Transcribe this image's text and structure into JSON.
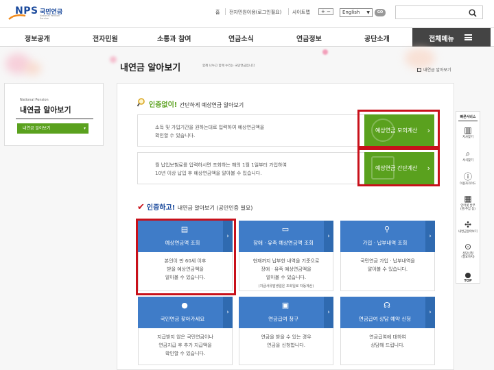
{
  "header": {
    "logo": {
      "brand": "NPS",
      "korean": "국민연금",
      "english": "National Pension Service"
    },
    "util_links": [
      "홈",
      "전자민원이용(로그인필요)",
      "사이트맵"
    ],
    "font_size": {
      "plus": "+",
      "minus": "−"
    },
    "language": {
      "selected": "English"
    },
    "go_label": "GO",
    "search": {
      "placeholder": ""
    }
  },
  "nav": {
    "items": [
      "정보공개",
      "전자민원",
      "소통과 참여",
      "연금소식",
      "연금정보",
      "공단소개"
    ],
    "all_menu": "전체메뉴"
  },
  "page": {
    "title": "내연금 알아보기",
    "subtitle": "함께 나누고 함께 누리는 국민연금입니다",
    "breadcrumb": "내연금 알아보기"
  },
  "sidebar": {
    "small_label": "National Pension",
    "title": "내연금 알아보기",
    "button": "내연금 알아보기"
  },
  "section1": {
    "heading_bold": "인증없이!",
    "heading_rest": "간단하게 예상연금 알아보기",
    "rows": [
      {
        "desc": "소득 및 가입기간을 원하는대로 입력하여 예상연금액을\n확인할 수 있습니다.",
        "button": "예상연금 모의계산"
      },
      {
        "desc": "월 납입보험료를 입력하시면 조회하는 해의 1월 1일부터 가입하여\n10년 이상 납입 후 예상연금액을 알아볼 수 있습니다.",
        "button": "예상연금 간단계산"
      }
    ]
  },
  "section2": {
    "heading_bold": "인증하고!",
    "heading_rest": "내연금 알아보기 (공인인증 필요)",
    "cards": [
      {
        "title": "예상연금액 조회",
        "icon": "document-icon",
        "desc": "본인이 만 60세 이후\n받을 예상연금액을\n알아볼 수 있습니다.",
        "note": ""
      },
      {
        "title": "장애 · 유족 예상연금액 조회",
        "icon": "id-card-icon",
        "desc": "현재까지 납부한 내역을 기준으로\n장애 · 유족 예상연금액을\n알아볼 수 있습니다.",
        "note": "(지급사유발생일은 조회일로 자동계산)"
      },
      {
        "title": "가입 · 납부내역 조회",
        "icon": "magnifier-icon",
        "desc": "국민연금 가입 · 납부내역을\n알아볼 수 있습니다.",
        "note": ""
      },
      {
        "title": "국민연금 찾아가세요",
        "icon": "piggy-bank-icon",
        "desc": "지급받지 않은 국민연금이나\n연금지급 후 추가 지급액을\n확인할 수 있습니다.",
        "note": ""
      },
      {
        "title": "연금급여 청구",
        "icon": "monitor-icon",
        "desc": "연금을 받을 수 있는 경우\n연금을 신청합니다.",
        "note": ""
      },
      {
        "title": "연금급여 상담 예약 신청",
        "icon": "headset-icon",
        "desc": "연금급여에 대하여\n상담해 드립니다.",
        "note": ""
      }
    ]
  },
  "quick": {
    "title": "빠른서비스",
    "items": [
      {
        "label": "지사찾기",
        "icon": "building-icon"
      },
      {
        "label": "서식찾기",
        "icon": "search-doc-icon"
      },
      {
        "label": "이용자가이드",
        "icon": "guide-icon"
      },
      {
        "label": "인터넷 납부\n(반/추납 등)",
        "icon": "card-icon"
      },
      {
        "label": "내연금알아보기",
        "icon": "pinwheel-icon"
      },
      {
        "label": "상담신청\n(필요하지)",
        "icon": "mouse-icon"
      }
    ],
    "top": "TOP"
  },
  "colors": {
    "green": "#5aa11e",
    "blue": "#3f7cc8",
    "navy": "#1b4a9c",
    "red": "#c8101a"
  }
}
